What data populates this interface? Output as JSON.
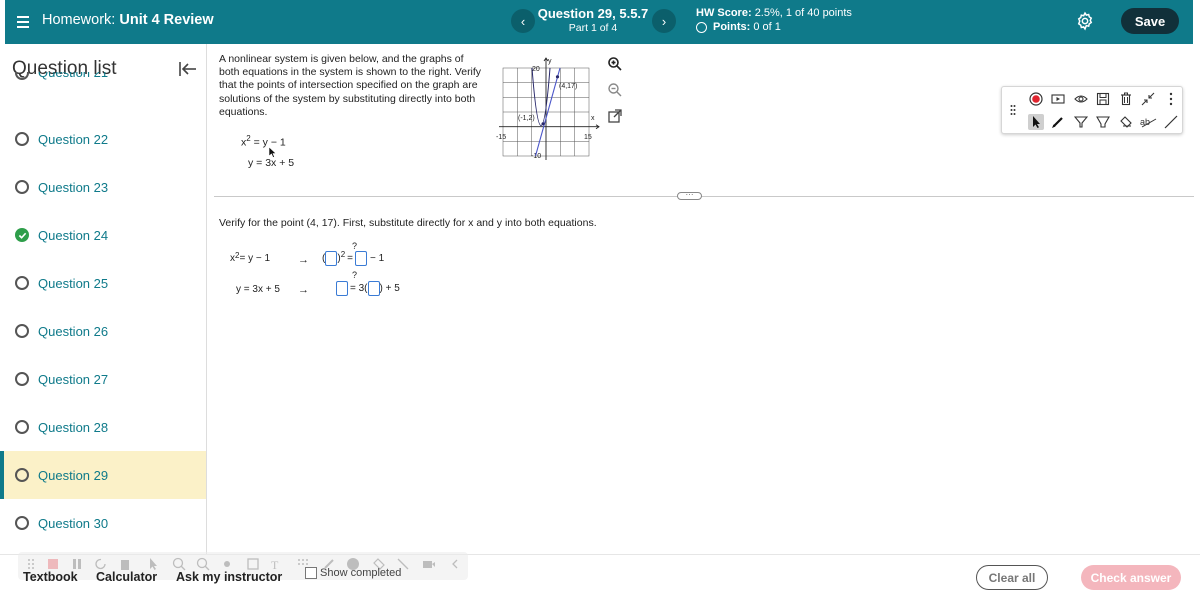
{
  "header": {
    "title_prefix": "Homework:",
    "title": "Unit 4 Review",
    "prev_label": "‹",
    "next_label": "›",
    "question_label": "Question 29, 5.5.7",
    "part_label": "Part 1 of 4",
    "hw_score_label": "HW Score:",
    "hw_score_value": "2.5%, 1 of 40 points",
    "points_label": "Points:",
    "points_value": "0 of 1",
    "save_label": "Save",
    "bar_color": "#0f7a8a"
  },
  "sidebar": {
    "title": "Question list",
    "partial_item": "Question 21",
    "items": [
      {
        "label": "Question 22",
        "status": "open"
      },
      {
        "label": "Question 23",
        "status": "open"
      },
      {
        "label": "Question 24",
        "status": "complete"
      },
      {
        "label": "Question 25",
        "status": "open"
      },
      {
        "label": "Question 26",
        "status": "open"
      },
      {
        "label": "Question 27",
        "status": "open"
      },
      {
        "label": "Question 28",
        "status": "open"
      },
      {
        "label": "Question 29",
        "status": "active"
      },
      {
        "label": "Question 30",
        "status": "open"
      }
    ]
  },
  "problem": {
    "text": "A nonlinear system is given below, and the graphs of both equations in the system is shown to the right. Verify that the points of intersection specified on the graph are solutions of the system by substituting directly into both equations.",
    "eq1_lhs": "x",
    "eq1_exp": "2",
    "eq1_rhs": "= y − 1",
    "eq2": "y = 3x + 5"
  },
  "graph": {
    "y_axis_label": "y",
    "x_axis_label": "x",
    "y_max_label": "20",
    "y_min_label": "-10",
    "x_min_label": "-15",
    "x_max_label": "15",
    "point_a": "(4,17)",
    "point_b": "(-1,2)"
  },
  "verify": {
    "instruction": "Verify for the point (4, 17). First, substitute directly for x and y into both equations.",
    "row1_lhs_base": "x",
    "row1_lhs_exp": "2",
    "row1_lhs_rest": " = y − 1",
    "row2_lhs": "y = 3x + 5",
    "arrow": "→",
    "qmark": "?",
    "sq_exp": "2",
    "minus_one": "− 1",
    "eq_3": "= 3(",
    "plus_5": ") + 5",
    "eq_sign": "="
  },
  "footer": {
    "textbook": "Textbook",
    "calculator": "Calculator",
    "ask": "Ask my instructor",
    "show_completed": "Show completed",
    "clear_all": "Clear all",
    "check_answer": "Check answer"
  }
}
